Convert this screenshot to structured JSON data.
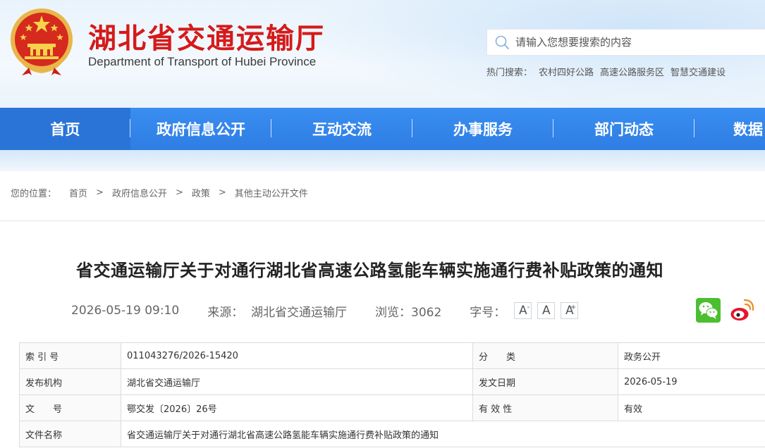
{
  "header": {
    "title": "湖北省交通运输厅",
    "subtitle": "Department of Transport of Hubei Province",
    "search_placeholder": "请输入您想要搜索的内容",
    "hot_label": "热门搜索：",
    "hot_links": [
      "农村四好公路",
      "高速公路服务区",
      "智慧交通建设"
    ]
  },
  "nav": {
    "items": [
      "首页",
      "政府信息公开",
      "互动交流",
      "办事服务",
      "部门动态",
      "数据"
    ]
  },
  "breadcrumb": {
    "label": "您的位置：",
    "items": [
      "首页",
      "政府信息公开",
      "政策",
      "其他主动公开文件"
    ],
    "separator": ">"
  },
  "article": {
    "title": "省交通运输厅关于对通行湖北省高速公路氢能车辆实施通行费补贴政策的通知",
    "datetime": "2026-05-19 09:10",
    "source": "来源：  湖北省交通运输厅",
    "views": "浏览：3062",
    "font_size_label": "字号：",
    "font_buttons": [
      "A",
      "A",
      "A"
    ],
    "font_button_marks": [
      "-",
      "",
      "+"
    ]
  },
  "info_table": {
    "rows": [
      [
        "索 引 号",
        "011043276/2026-15420",
        "分　　类",
        "政务公开"
      ],
      [
        "发布机构",
        "湖北省交通运输厅",
        "发文日期",
        "2026-05-19"
      ],
      [
        "文　　号",
        "鄂交发〔2026〕26号",
        "有 效 性",
        "有效"
      ],
      [
        "文件名称",
        "省交通运输厅关于对通行湖北省高速公路氢能车辆实施通行费补贴政策的通知",
        "",
        ""
      ]
    ]
  },
  "colors": {
    "title_red": "#d51a1a",
    "nav_blue": "#2e7de4",
    "wechat_green": "#4cbf30",
    "weibo_red": "#e6162d"
  }
}
